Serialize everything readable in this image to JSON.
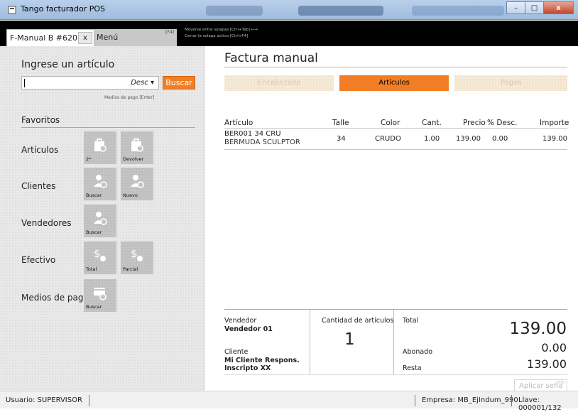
{
  "window": {
    "title": "Tango facturador POS",
    "min_label": "–",
    "max_label": "□",
    "close_label": "x"
  },
  "tabs": {
    "active_label": "F-Manual B #620",
    "close_label": "x",
    "menu_label": "Menú",
    "menu_key": "[F4]",
    "hint_line1": "Moverse entre solapas [Ctrl+Tab] ←→",
    "hint_line2": "Cerrar la solapa activa [Ctrl+F4]"
  },
  "left": {
    "heading": "Ingrese un artículo",
    "search": {
      "value": "",
      "mode": "Desc",
      "button": "Buscar",
      "hint": "Medios de pago  [Enter]"
    },
    "favorites_title": "Favoritos",
    "categories": [
      {
        "label": "Artículos",
        "tiles": [
          {
            "icon": "bag-search-icon",
            "label": "2*"
          },
          {
            "icon": "bag-return-icon",
            "label": "Devolver"
          }
        ]
      },
      {
        "label": "Clientes",
        "tiles": [
          {
            "icon": "person-search-icon",
            "label": "Buscar"
          },
          {
            "icon": "person-add-icon",
            "label": "Nuevo"
          }
        ]
      },
      {
        "label": "Vendedores",
        "tiles": [
          {
            "icon": "seller-search-icon",
            "label": "Buscar"
          }
        ]
      },
      {
        "label": "Efectivo",
        "tiles": [
          {
            "icon": "cash-total-icon",
            "label": "Total"
          },
          {
            "icon": "cash-partial-icon",
            "label": "Parcial"
          }
        ]
      },
      {
        "label": "Medios de pago",
        "tiles": [
          {
            "icon": "card-search-icon",
            "label": "Buscar"
          }
        ]
      }
    ]
  },
  "main": {
    "title": "Factura manual",
    "steps": [
      "Encabezado",
      "Artículos",
      "Pagos"
    ],
    "columns": {
      "articulo": "Artículo",
      "talle": "Talle",
      "color": "Color",
      "cant": "Cant.",
      "precio": "Precio",
      "desc": "% Desc.",
      "importe": "Importe"
    },
    "rows": [
      {
        "code": "BER001  34 CRU",
        "description": "BERMUDA SCULPTOR",
        "talle": "34",
        "color": "CRUDO",
        "cant": "1.00",
        "precio": "139.00",
        "desc": "0.00",
        "importe": "139.00"
      }
    ],
    "summary": {
      "vendedor_label": "Vendedor",
      "vendedor": "Vendedor 01",
      "cliente_label": "Cliente",
      "cliente_line1": "Mi Cliente Respons.",
      "cliente_line2": "Inscripto XX",
      "cantidad_label": "Cantidad de artículos",
      "cantidad": "1",
      "total_label": "Total",
      "total": "139.00",
      "abonado_label": "Abonado",
      "abonado": "0.00",
      "resta_label": "Resta",
      "resta": "139.00",
      "aplicar_label": "Aplicar seña",
      "aplicar_key": "[F9]"
    }
  },
  "status": {
    "usuario": "Usuario: SUPERVISOR",
    "empresa": "Empresa: MB_EjIndum_990",
    "llave": "Llave: 000001/132"
  }
}
